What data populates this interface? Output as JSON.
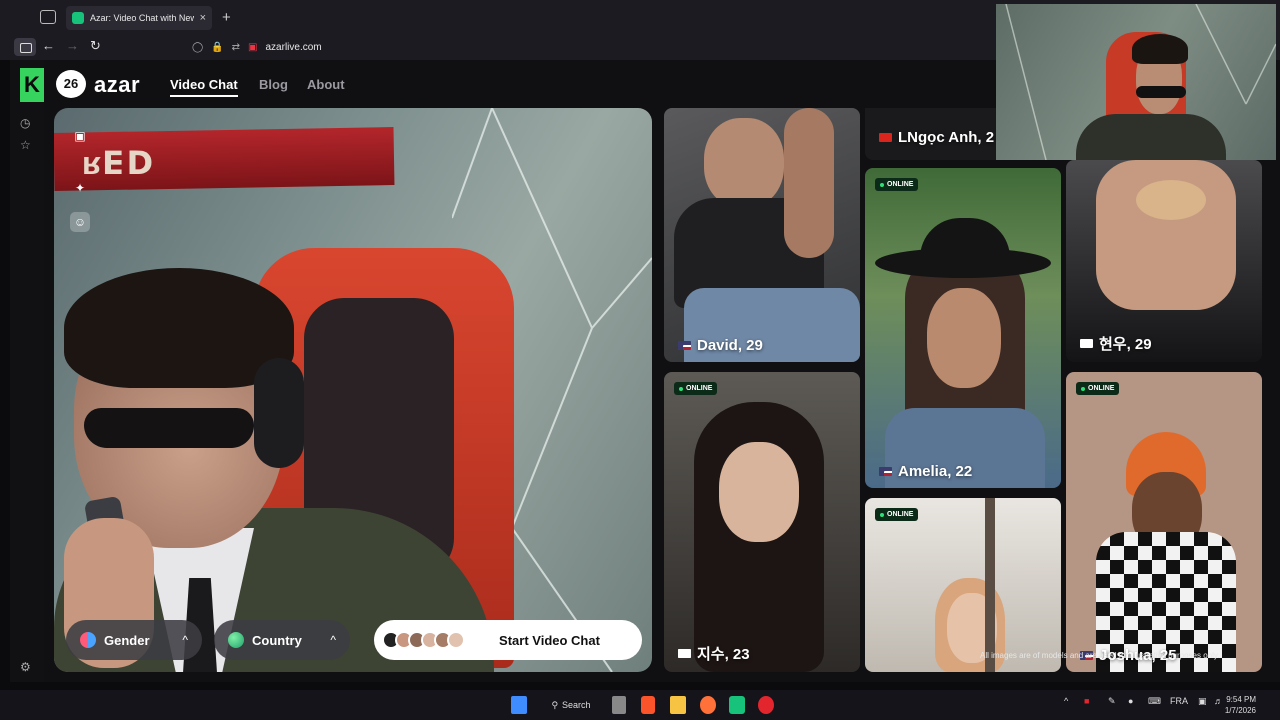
{
  "browser": {
    "tab_title": "Azar: Video Chat with New Peo",
    "tab_close": "×",
    "new_tab": "+",
    "url": "azarlive.com",
    "back": "←",
    "forward": "→",
    "reload": "↻"
  },
  "site": {
    "logo_badge": "26",
    "logo_text": "azar",
    "nav": [
      {
        "label": "Video Chat",
        "active": true
      },
      {
        "label": "Blog",
        "active": false
      },
      {
        "label": "About",
        "active": false
      }
    ]
  },
  "filters": {
    "gender_label": "Gender",
    "country_label": "Country",
    "chevron": "^"
  },
  "start_button": {
    "label": "Start Video Chat"
  },
  "cards": [
    {
      "name": "David, 29",
      "flag": "us",
      "online": false
    },
    {
      "name": "지수, 23",
      "flag": "kr",
      "online": true
    },
    {
      "name": "LNgọc Anh, 2",
      "flag": "vn",
      "online": false
    },
    {
      "name": "Amelia, 22",
      "flag": "us",
      "online": true
    },
    {
      "name": "",
      "flag": "",
      "online": true
    },
    {
      "name": "현우, 29",
      "flag": "kr",
      "online": false
    },
    {
      "name": "Joshua, 25",
      "flag": "us",
      "online": true
    }
  ],
  "online_label": "ONLINE",
  "disclaimer": "All images are of models and are used for illustrative purposes only.",
  "taskbar": {
    "search_label": "Search",
    "lang": "FRA",
    "time": "9:54 PM",
    "date": "1/7/2026"
  },
  "colors": {
    "accent_green": "#36d35f",
    "online_green": "#2ee07a"
  }
}
